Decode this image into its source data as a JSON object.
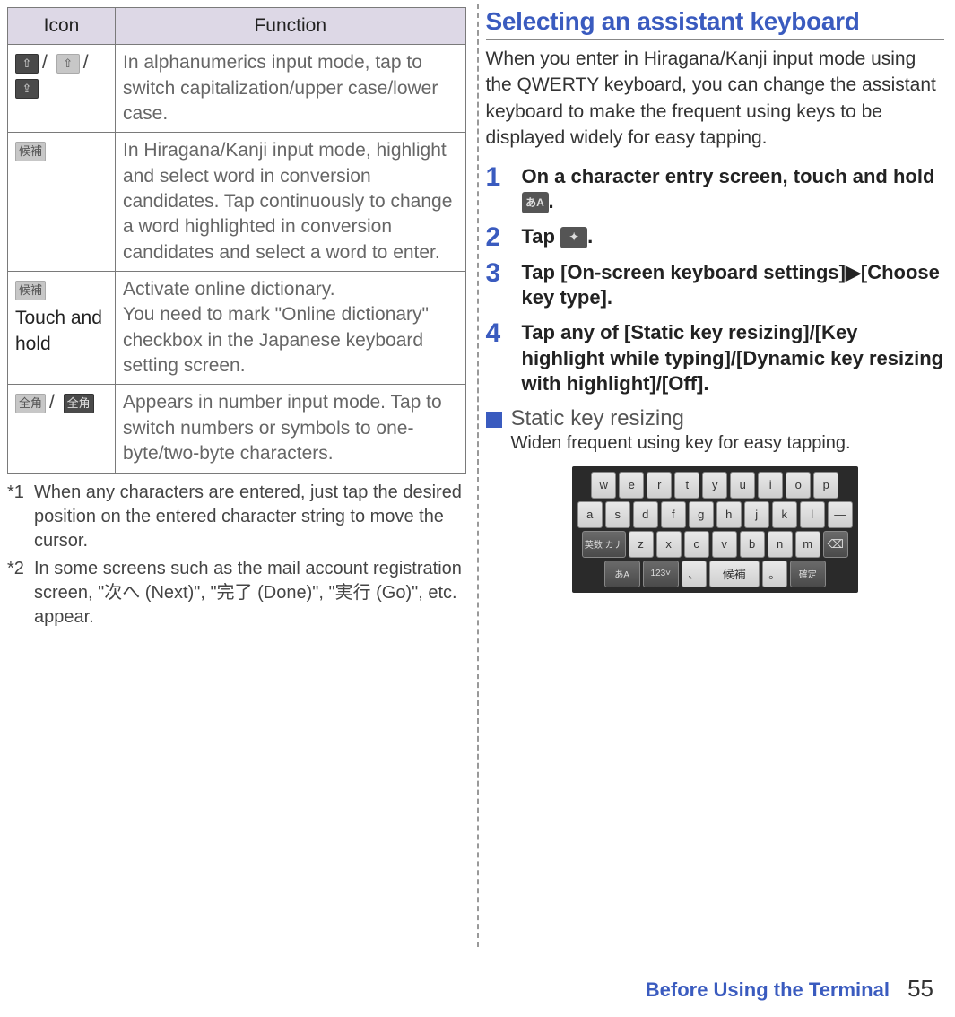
{
  "table": {
    "headers": {
      "icon": "Icon",
      "function": "Function"
    },
    "rows": [
      {
        "icon_extra": "",
        "function": "In alphanumerics input mode, tap to switch capitalization/upper case/lower case."
      },
      {
        "icon_extra": "",
        "function": "In Hiragana/Kanji input mode, highlight and select word in conversion candidates. Tap continuously to change a word highlighted in conversion candidates and select a word to enter."
      },
      {
        "icon_extra": "Touch and hold",
        "function": "Activate online dictionary.\nYou need to mark \"Online dictionary\" checkbox in the Japanese keyboard setting screen."
      },
      {
        "icon_extra": "",
        "function": "Appears in number input mode. Tap to switch numbers or symbols to one-byte/two-byte characters."
      }
    ]
  },
  "footnotes": {
    "f1_mark": "*1",
    "f1": "When any characters are entered, just tap the desired position on the entered character string to move the cursor.",
    "f2_mark": "*2",
    "f2": "In some screens such as the mail account registration screen, \"次へ (Next)\", \"完了 (Done)\", \"実行 (Go)\", etc. appear."
  },
  "right": {
    "title": "Selecting an assistant keyboard",
    "intro": "When you enter in Hiragana/Kanji input mode using the QWERTY keyboard, you can change the assistant keyboard to make the frequent using keys to be displayed widely for easy tapping.",
    "steps": {
      "s1": "On a character entry screen, touch and hold ",
      "s1b": ".",
      "s2a": "Tap ",
      "s2b": ".",
      "s3": "Tap [On-screen keyboard settings]▶[Choose key type].",
      "s4": "Tap any of [Static key resizing]/[Key highlight while typing]/[Dynamic key resizing with highlight]/[Off]."
    },
    "sub": {
      "title": "Static key resizing",
      "desc": "Widen frequent using key for easy tapping."
    }
  },
  "keyboard": {
    "row1": [
      "w",
      "e",
      "r",
      "t",
      "y",
      "u",
      "i",
      "o",
      "p"
    ],
    "row2": [
      "a",
      "s",
      "d",
      "f",
      "g",
      "h",
      "j",
      "k",
      "l",
      "—"
    ],
    "row3_mode": "英数\nカナ",
    "row3": [
      "z",
      "x",
      "c",
      "v",
      "b",
      "n",
      "m"
    ],
    "row3_del": "⌫",
    "row4_lang": "あA",
    "row4_num": "123˅",
    "row4_left": "、",
    "row4_cand": "候補",
    "row4_right": "。",
    "row4_ok": "確定"
  },
  "footer": {
    "section": "Before Using the Terminal",
    "page": "55"
  }
}
